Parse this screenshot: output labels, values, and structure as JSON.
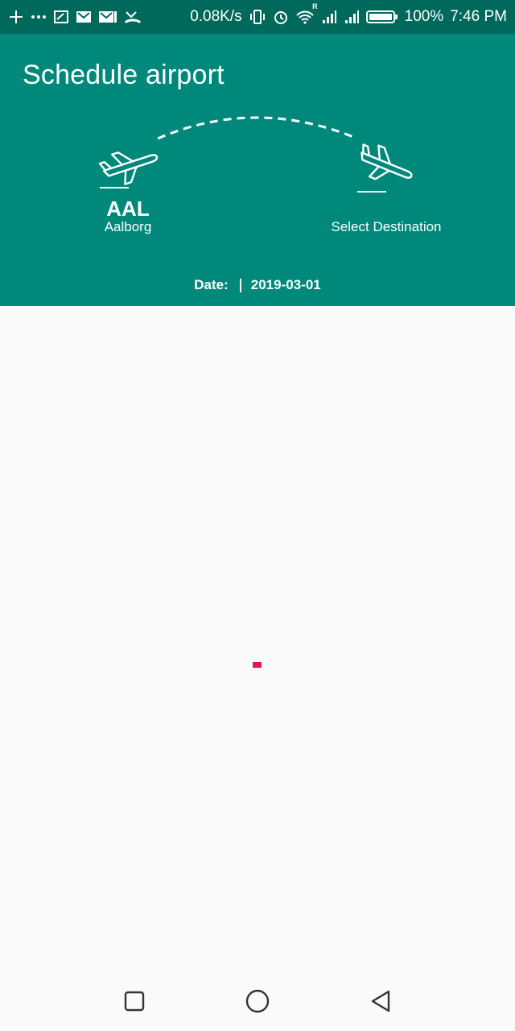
{
  "status_bar": {
    "net_speed": "0.08K/s",
    "roaming_indicator": "R",
    "battery_percent": "100%",
    "time": "7:46 PM",
    "left_icons": [
      "add-icon",
      "more-icon",
      "cast-icon",
      "gmail-icon",
      "gmail-icon",
      "missed-call-icon"
    ],
    "right_icons": [
      "vibrate-icon",
      "alarm-icon",
      "wifi-icon",
      "signal-icon",
      "signal-icon",
      "battery-icon"
    ]
  },
  "header": {
    "title": "Schedule airport",
    "origin": {
      "code": "AAL",
      "name": "Aalborg"
    },
    "destination": {
      "placeholder": "Select Destination"
    },
    "date": {
      "label": "Date:",
      "value": "2019-03-01"
    }
  },
  "colors": {
    "status_bar": "#00695c",
    "header": "#00897b",
    "background": "#fafafa",
    "loader": "#d81b60"
  },
  "nav": {
    "icons": [
      "recents-icon",
      "home-icon",
      "back-icon"
    ]
  }
}
